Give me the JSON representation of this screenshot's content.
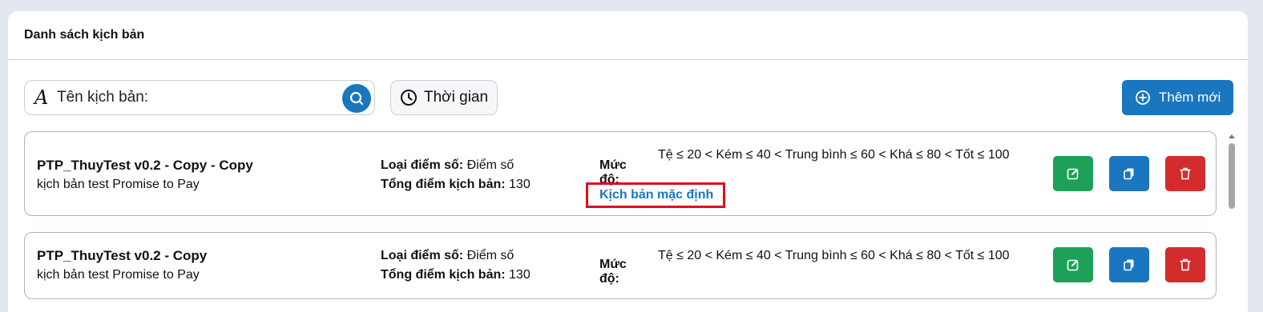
{
  "panel": {
    "title": "Danh sách kịch bản"
  },
  "toolbar": {
    "search_placeholder": "Tên kịch bản:",
    "time_label": "Thời gian",
    "add_label": "Thêm mới"
  },
  "labels": {
    "score_type": "Loại điểm số:",
    "total_score": "Tổng điểm kịch bản:",
    "level": "Mức độ:"
  },
  "scripts": [
    {
      "name": "PTP_ThuyTest v0.2 - Copy - Copy",
      "description": "kịch bản test Promise to Pay",
      "score_type": "Điểm số",
      "total_score": "130",
      "level_text": "Tệ ≤ 20 < Kém ≤ 40 < Trung bình ≤ 60 < Khá ≤ 80 < Tốt ≤ 100",
      "default_tag": "Kịch bản mặc định"
    },
    {
      "name": "PTP_ThuyTest v0.2 - Copy",
      "description": "kịch bản test Promise to Pay",
      "score_type": "Điểm số",
      "total_score": "130",
      "level_text": "Tệ ≤ 20 < Kém ≤ 40 < Trung bình ≤ 60 < Khá ≤ 80 < Tốt ≤ 100"
    }
  ],
  "colors": {
    "primary": "#1a76bf",
    "success": "#1da158",
    "danger": "#d22c2d",
    "highlight_border": "#e10d1d"
  },
  "icons": {
    "search": "search-icon",
    "time": "clock-icon",
    "add": "plus-circle-icon",
    "edit": "edit-icon",
    "copy": "copy-icon",
    "delete": "trash-icon"
  }
}
